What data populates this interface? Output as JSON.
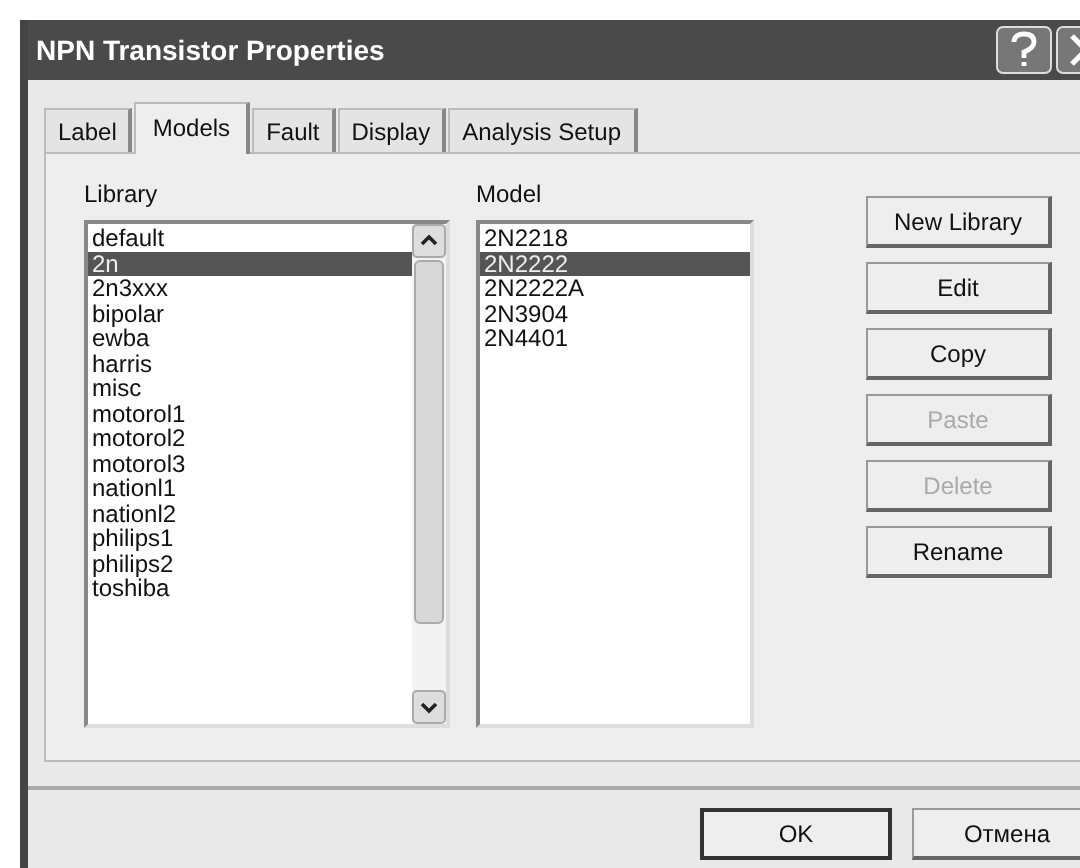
{
  "window": {
    "title": "NPN Transistor Properties"
  },
  "tabs": [
    {
      "label": "Label",
      "selected": false
    },
    {
      "label": "Models",
      "selected": true
    },
    {
      "label": "Fault",
      "selected": false
    },
    {
      "label": "Display",
      "selected": false
    },
    {
      "label": "Analysis Setup",
      "selected": false
    }
  ],
  "library": {
    "label": "Library",
    "items": [
      {
        "name": "default",
        "selected": false
      },
      {
        "name": "2n",
        "selected": true
      },
      {
        "name": "2n3xxx",
        "selected": false
      },
      {
        "name": "bipolar",
        "selected": false
      },
      {
        "name": "ewba",
        "selected": false
      },
      {
        "name": "harris",
        "selected": false
      },
      {
        "name": "misc",
        "selected": false
      },
      {
        "name": "motorol1",
        "selected": false
      },
      {
        "name": "motorol2",
        "selected": false
      },
      {
        "name": "motorol3",
        "selected": false
      },
      {
        "name": "nationl1",
        "selected": false
      },
      {
        "name": "nationl2",
        "selected": false
      },
      {
        "name": "philips1",
        "selected": false
      },
      {
        "name": "philips2",
        "selected": false
      },
      {
        "name": "toshiba",
        "selected": false
      }
    ]
  },
  "model": {
    "label": "Model",
    "items": [
      {
        "name": "2N2218",
        "selected": false
      },
      {
        "name": "2N2222",
        "selected": true
      },
      {
        "name": "2N2222A",
        "selected": false
      },
      {
        "name": "2N3904",
        "selected": false
      },
      {
        "name": "2N4401",
        "selected": false
      }
    ]
  },
  "side_buttons": [
    {
      "label": "New Library",
      "disabled": false
    },
    {
      "label": "Edit",
      "disabled": false
    },
    {
      "label": "Copy",
      "disabled": false
    },
    {
      "label": "Paste",
      "disabled": true
    },
    {
      "label": "Delete",
      "disabled": true
    },
    {
      "label": "Rename",
      "disabled": false
    }
  ],
  "footer_buttons": [
    {
      "label": "OK",
      "default": true
    },
    {
      "label": "Отмена",
      "default": false
    }
  ]
}
